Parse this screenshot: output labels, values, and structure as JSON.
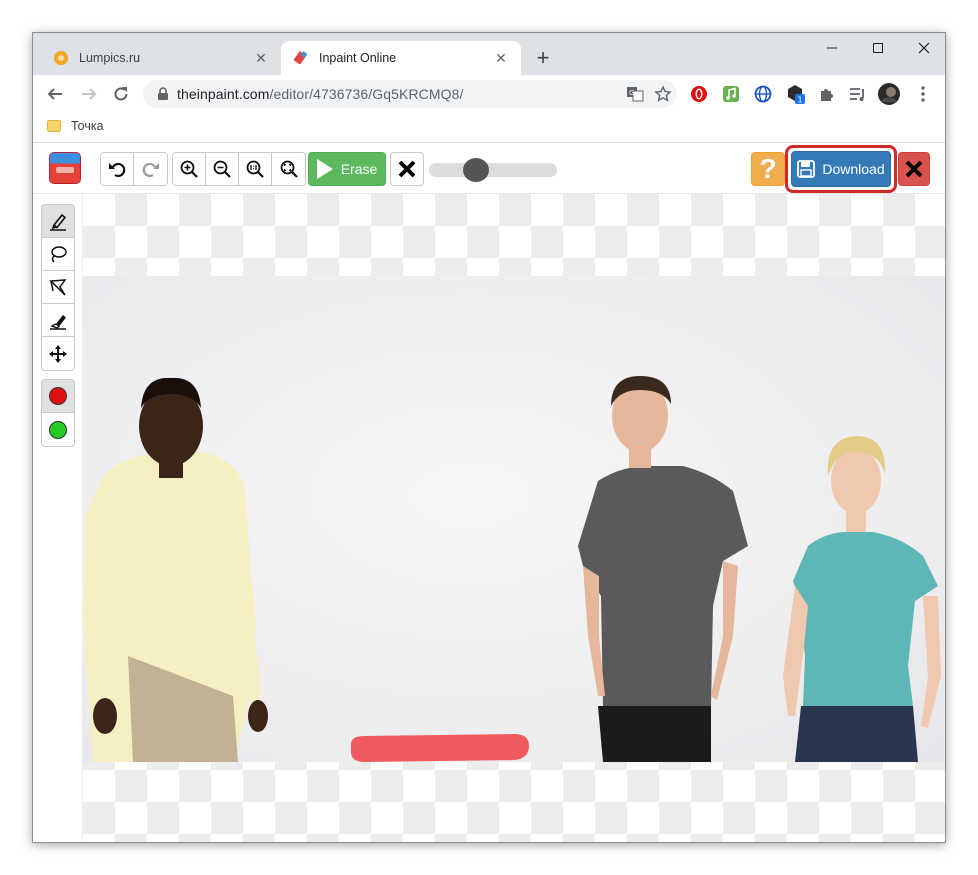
{
  "browser": {
    "tabs": [
      {
        "title": "Lumpics.ru",
        "active": false,
        "favicon": "orange-circle-icon"
      },
      {
        "title": "Inpaint Online",
        "active": true,
        "favicon": "inpaint-eraser-icon"
      }
    ],
    "new_tab": "+",
    "address": {
      "host": "theinpaint.com",
      "path": "/editor/4736736/Gq5KRCMQ8/"
    },
    "extension_badge": "1",
    "bookmarks": [
      {
        "label": "Точка"
      }
    ]
  },
  "editor": {
    "erase_label": "Erase",
    "help_label": "?",
    "download_label": "Download",
    "brush_size_fraction": 0.33,
    "colors": {
      "red_marker": "#e01010",
      "green_marker": "#22cc22",
      "erase_green": "#5cb85c",
      "download_blue": "#337ab7",
      "help_orange": "#f0ad4e",
      "close_red": "#d9534f",
      "highlight_red": "#d12a2a"
    }
  }
}
